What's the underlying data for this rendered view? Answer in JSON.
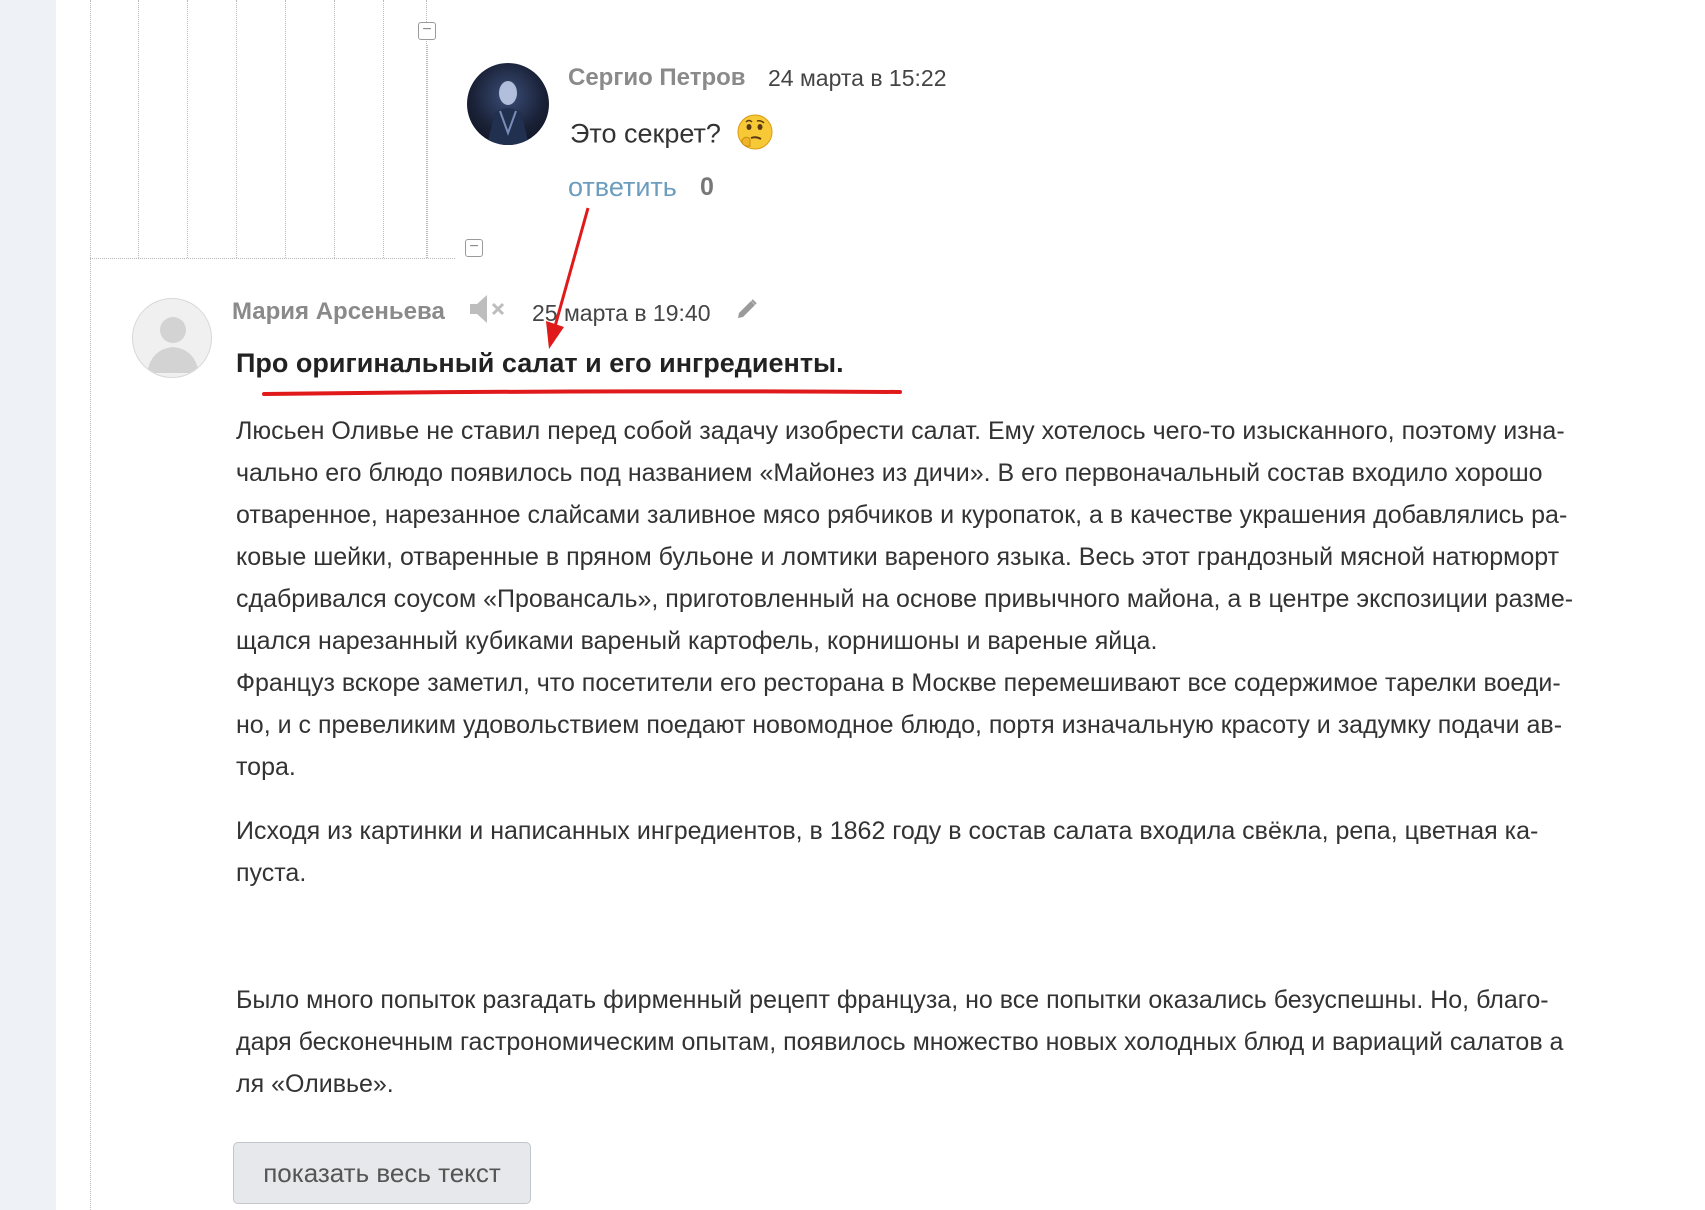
{
  "comment_reply": {
    "author": "Сергио Петров",
    "date": "24 марта в 15:22",
    "text": "Это секрет?",
    "reply_label": "ответить",
    "reply_count": "0"
  },
  "comment_main": {
    "author": "Мария Арсеньева",
    "date": "25 марта в 19:40",
    "heading": "Про оригинальный салат и его ингредиенты.",
    "paragraph1": [
      "Люсьен Оливье не ставил перед собой задачу изобрести салат. Ему хотелось чего-то изысканного, поэтому изна-",
      "чально его блюдо появилось под названием «Майонез из дичи». В его первоначальный состав входило хорошо",
      "отваренное, нарезанное слайсами заливное мясо рябчиков и куропаток, а в качестве украшения добавлялись ра-",
      "ковые шейки, отваренные в пряном бульоне и ломтики вареного языка. Весь этот грандозный мясной натюрморт",
      "сдабривался соусом «Провансаль», приготовленный на основе привычного майона, а в центре экспозиции разме-",
      "щался нарезанный кубиками вареный картофель, корнишоны и вареные яйца.",
      "Француз вскоре заметил, что посетители его ресторана в Москве перемешивают все содержимое тарелки воеди-",
      "но, и с превеликим удовольствием поедают новомодное блюдо, портя изначальную красоту и задумку подачи ав-",
      "тора."
    ],
    "paragraph2": [
      "Исходя из картинки и написанных ингредиентов, в 1862 году в состав салата входила свёкла, репа, цветная ка-",
      "пуста."
    ],
    "paragraph3": [
      "Было много попыток разгадать фирменный рецепт француза, но все попытки оказались безуспешны. Но, благо-",
      "даря бесконечным гастрономическим опытам, появилось множество новых холодных блюд и вариаций салатов а",
      "ля «Оливье»."
    ],
    "show_all_label": "показать весь текст"
  },
  "icons": {
    "collapse": "collapse-minus-icon",
    "mute": "mute-speaker-icon",
    "edit": "pencil-icon",
    "emoji": "thinking-face-icon"
  },
  "colors": {
    "link": "#6c9dbf",
    "annotation": "#e01a1a",
    "author": "#8a8a8a"
  }
}
